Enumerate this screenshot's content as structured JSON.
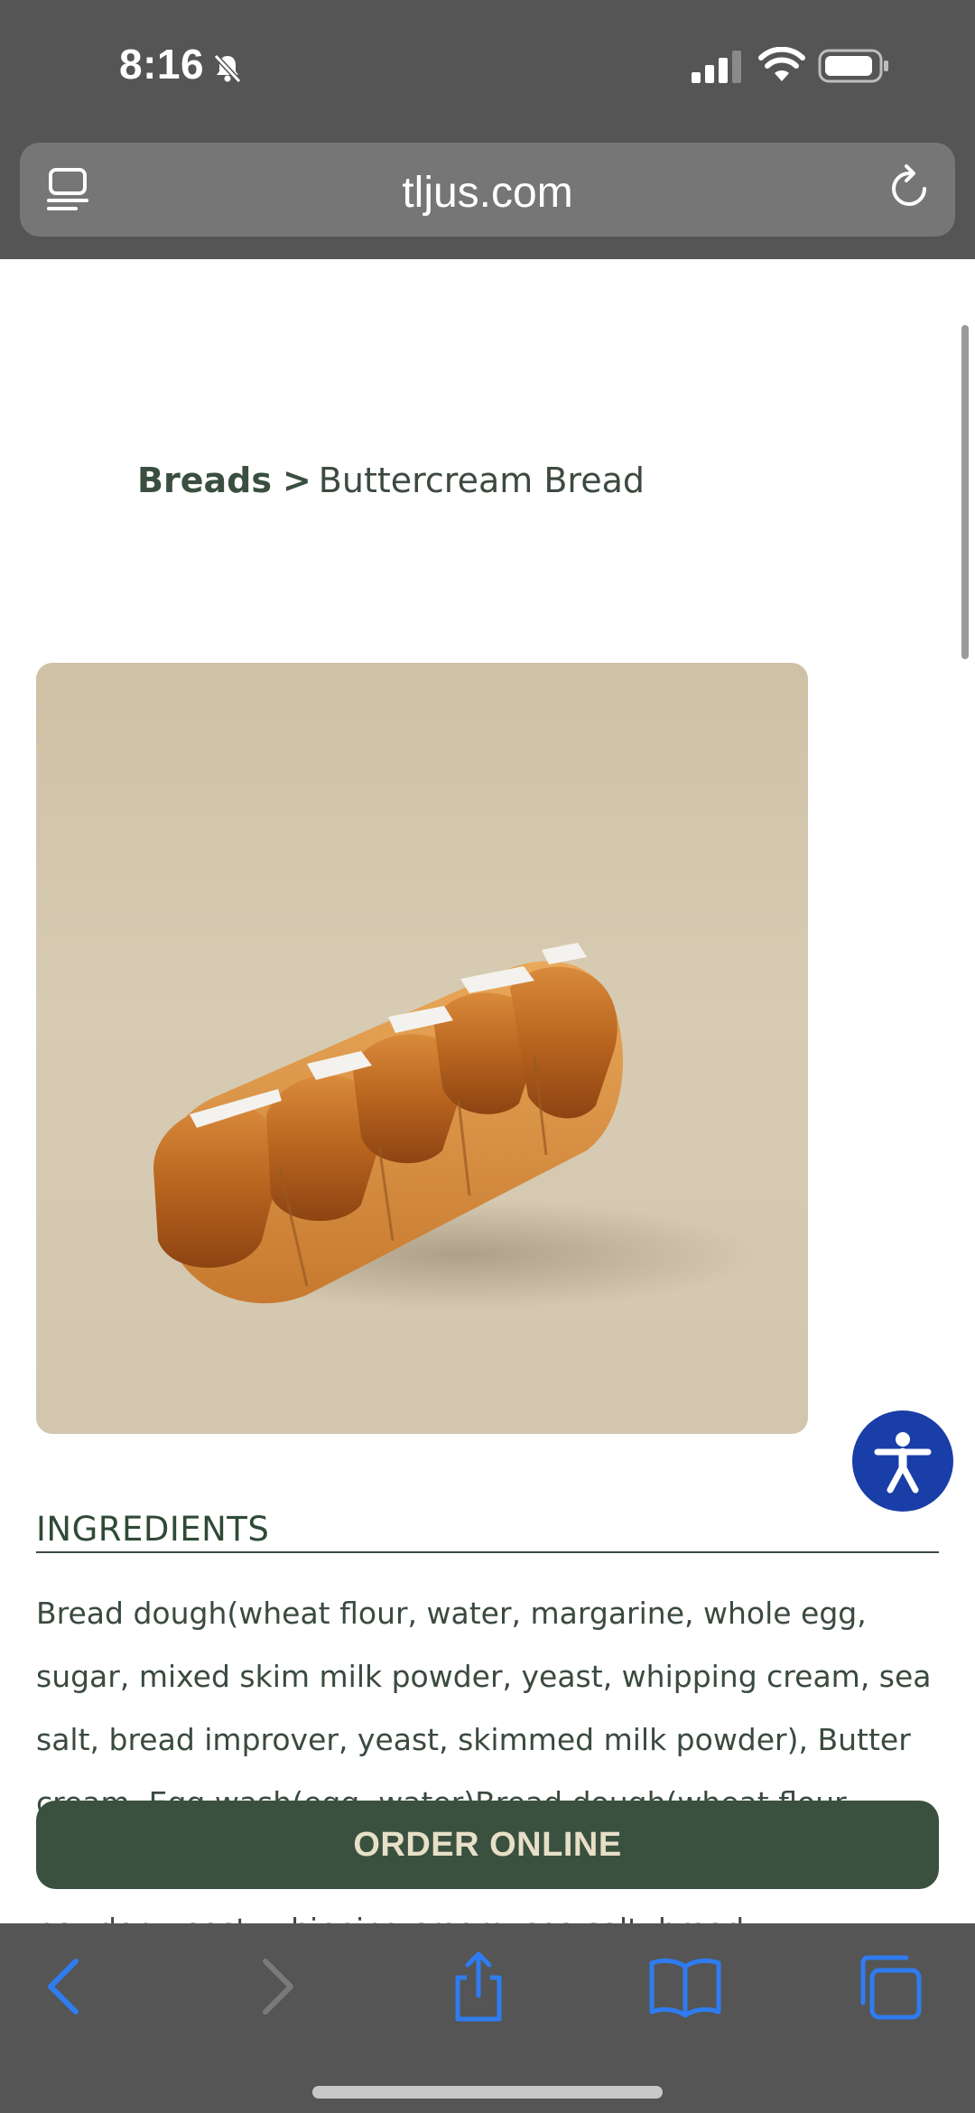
{
  "status_bar": {
    "time": "8:16"
  },
  "browser": {
    "url": "tljus.com"
  },
  "breadcrumb": {
    "parent": "Breads",
    "separator": ">",
    "current": "Buttercream Bread"
  },
  "product": {
    "image_alt": "Buttercream Bread"
  },
  "ingredients": {
    "heading": "INGREDIENTS",
    "text": "Bread dough(wheat flour, water, margarine, whole egg, sugar, mixed skim milk powder, yeast, whipping cream, sea salt, bread improver, yeast, skimmed milk powder), Butter cream, Egg wash(egg, water)Bread dough(wheat flour, water, margarine, whole egg, sugar, mixed skim milk powder, yeast, whipping cream, sea salt, bread"
  },
  "cta": {
    "order_label": "ORDER ONLINE"
  },
  "colors": {
    "brand_green": "#3b5140",
    "accessibility_blue": "#1a3ea8",
    "toolbar_icon_blue": "#2f7cf0"
  }
}
